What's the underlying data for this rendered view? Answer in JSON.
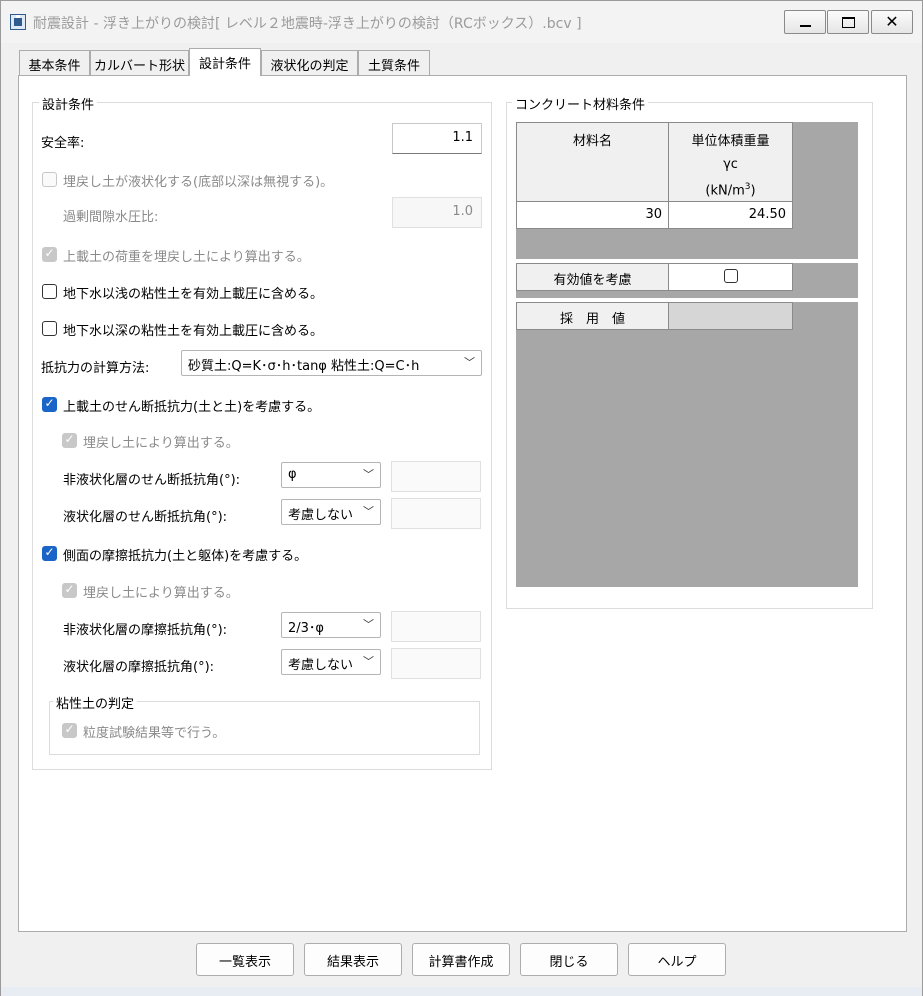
{
  "window": {
    "title": "耐震設計 - 浮き上がりの検討[ レベル２地震時-浮き上がりの検討（RCボックス）.bcv ]"
  },
  "icons": {
    "app": "app-window-icon",
    "minimize": "minimize-icon",
    "maximize": "maximize-icon",
    "close": "close-icon",
    "dropdown": "chevron-down-icon",
    "check": "checkmark-icon"
  },
  "colors": {
    "accent": "#1a65c7",
    "grid_background": "#a7a7a7"
  },
  "tabs": [
    "基本条件",
    "カルバート形状",
    "設計条件",
    "液状化の判定",
    "土質条件"
  ],
  "active_tab": "設計条件",
  "design": {
    "group_title": "設計条件",
    "safety_factor_label": "安全率:",
    "safety_factor_value": "1.1",
    "backfill_liquefy_label": "埋戻し土が液状化する(底部以深は無視する)。",
    "backfill_liquefy_checked": false,
    "excess_pore_label": "過剰間隙水圧比:",
    "excess_pore_value": "1.0",
    "overburden_load_label": "上載土の荷重を埋戻し土により算出する。",
    "overburden_load_checked": true,
    "cohesive_shallow_label": "地下水以浅の粘性土を有効上載圧に含める。",
    "cohesive_shallow_checked": false,
    "cohesive_deep_label": "地下水以深の粘性土を有効上載圧に含める。",
    "cohesive_deep_checked": false,
    "resistance_method_label": "抵抗力の計算方法:",
    "resistance_method_value": "砂質土:Q=K･σ･h･tanφ  粘性土:Q=C･h",
    "shear_label": "上載土のせん断抵抗力(土と土)を考慮する。",
    "shear_checked": true,
    "shear_backfill_label": "埋戻し土により算出する。",
    "shear_backfill_checked": true,
    "shear_nonliq_label": "非液状化層のせん断抵抗角(°):",
    "shear_nonliq_value": "φ",
    "shear_liq_label": "液状化層のせん断抵抗角(°):",
    "shear_liq_value": "考慮しない",
    "friction_label": "側面の摩擦抵抗力(土と躯体)を考慮する。",
    "friction_checked": true,
    "friction_backfill_label": "埋戻し土により算出する。",
    "friction_backfill_checked": true,
    "friction_nonliq_label": "非液状化層の摩擦抵抗角(°):",
    "friction_nonliq_value": "2/3･φ",
    "friction_liq_label": "液状化層の摩擦抵抗角(°):",
    "friction_liq_value": "考慮しない",
    "cohesive_group_title": "粘性土の判定",
    "grain_test_label": "粒度試験結果等で行う。",
    "grain_test_checked": true
  },
  "concrete": {
    "group_title": "コンクリート材料条件",
    "col_material": "材料名",
    "col_weight_l1": "単位体積重量",
    "col_weight_l2": "γc",
    "col_weight_unit_base": "(kN/m",
    "col_weight_unit_sup": "3",
    "col_weight_unit_end": ")",
    "row_material": "30",
    "row_weight": "24.50",
    "effective_label": "有効値を考慮",
    "effective_checked": false,
    "adopted_label": "採　用　値",
    "adopted_value": ""
  },
  "buttons": {
    "list": "一覧表示",
    "result": "結果表示",
    "report": "計算書作成",
    "close": "閉じる",
    "help": "ヘルプ"
  }
}
